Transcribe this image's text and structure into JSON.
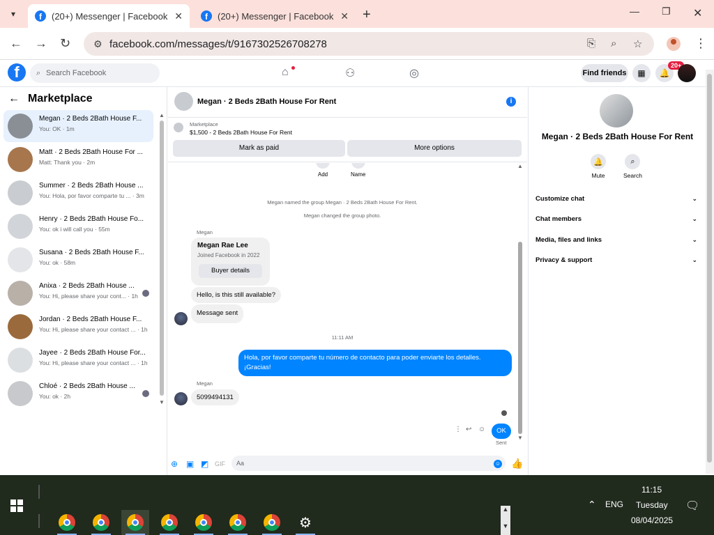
{
  "browser": {
    "tabs": [
      {
        "title": "(20+) Messenger | Facebook",
        "active": true
      },
      {
        "title": "(20+) Messenger | Facebook",
        "active": false
      }
    ],
    "url": "facebook.com/messages/t/9167302526708278"
  },
  "fb": {
    "search_placeholder": "Search Facebook",
    "find_friends": "Find friends",
    "notif_badge": "20+"
  },
  "left": {
    "title": "Marketplace",
    "conversations": [
      {
        "name": "Megan · 2 Beds 2Bath House F...",
        "snippet": "You: OK · 1m",
        "selected": true
      },
      {
        "name": "Matt · 2 Beds 2Bath House For ...",
        "snippet": "Matt: Thank you · 2m"
      },
      {
        "name": "Summer · 2 Beds 2Bath House ...",
        "snippet": "You: Hola, por favor comparte tu ... · 3m"
      },
      {
        "name": "Henry · 2 Beds 2Bath House Fo...",
        "snippet": "You: ok i will call you · 55m"
      },
      {
        "name": "Susana · 2 Beds 2Bath House F...",
        "snippet": "You: ok · 58m"
      },
      {
        "name": "Anixa · 2 Beds 2Bath House ...",
        "snippet": "You: Hi, please share your cont... · 1h"
      },
      {
        "name": "Jordan · 2 Beds 2Bath House F...",
        "snippet": "You: Hi, please share your contact ... · 1h"
      },
      {
        "name": "Jayee · 2 Beds 2Bath House For...",
        "snippet": "You: Hi, please share your contact ... · 1h"
      },
      {
        "name": "Chloé · 2 Beds 2Bath House ...",
        "snippet": "You: ok · 2h"
      }
    ]
  },
  "chat": {
    "title": "Megan · 2 Beds 2Bath House For Rent",
    "marketplace_label": "Marketplace",
    "listing": "$1,500 - 2 Beds 2Bath House For Rent",
    "mark_paid": "Mark as paid",
    "more_options": "More options",
    "actions": {
      "add": "Add",
      "name": "Name"
    },
    "sys1": "Megan named the group Megan · 2 Beds 2Bath House For Rent.",
    "sys2": "Megan changed the group photo.",
    "sender": "Megan",
    "card_name": "Megan Rae Lee",
    "card_sub": "Joined Facebook in 2022",
    "buyer_details": "Buyer details",
    "msg1": "Hello, is this still available?",
    "msg2": "Message sent",
    "time": "11:11 AM",
    "my_msg": "Hola, por favor comparte tu número de contacto para poder enviarte los detalles. ¡Gracias!",
    "sender2": "Megan",
    "msg3": "5099494131",
    "ok": "OK",
    "sent": "Sent",
    "composer_placeholder": "Aa"
  },
  "right": {
    "name": "Megan · 2 Beds 2Bath House For Rent",
    "mute": "Mute",
    "search": "Search",
    "rows": [
      "Customize chat",
      "Chat members",
      "Media, files and links",
      "Privacy & support"
    ]
  },
  "taskbar": {
    "time": "11:15",
    "day": "Tuesday",
    "date": "08/04/2025",
    "lang": "ENG"
  }
}
